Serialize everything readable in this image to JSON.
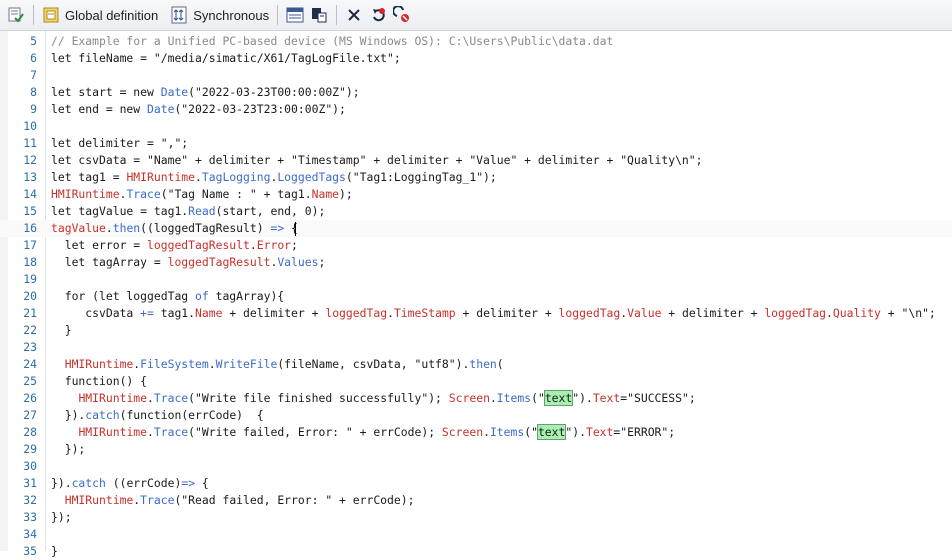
{
  "toolbar": {
    "global_definition_label": "Global definition",
    "synchronous_label": "Synchronous",
    "icons": [
      "check-script-icon",
      "global-definition-icon",
      "synchronous-icon",
      "tag-list-icon",
      "snippet-icon",
      "delete-icon",
      "refresh-icon",
      "stop-icon"
    ]
  },
  "colors": {
    "line_number": "#2b6da8",
    "object": "#c8312b",
    "member": "#3b6cc9",
    "comment": "#8a8a8a",
    "highlight": "#a8f0b0"
  },
  "editor": {
    "lines": [
      {
        "num": "5",
        "segments": [
          {
            "t": "// Example for a Unified PC-based device (MS Windows OS): C:\\Users\\Public\\data.dat",
            "c": "cmt"
          }
        ]
      },
      {
        "num": "6",
        "segments": [
          {
            "t": "let fileName = \"/media/simatic/X61/TagLogFile.txt\";",
            "c": "key"
          }
        ]
      },
      {
        "num": "7",
        "segments": []
      },
      {
        "num": "8",
        "segments": [
          {
            "t": "let start = new ",
            "c": "key"
          },
          {
            "t": "Date",
            "c": "blu"
          },
          {
            "t": "(\"2022-03-23T00:00:00Z\");",
            "c": "key"
          }
        ]
      },
      {
        "num": "9",
        "segments": [
          {
            "t": "let end = new ",
            "c": "key"
          },
          {
            "t": "Date",
            "c": "blu"
          },
          {
            "t": "(\"2022-03-23T23:00:00Z\");",
            "c": "key"
          }
        ]
      },
      {
        "num": "10",
        "segments": []
      },
      {
        "num": "11",
        "segments": [
          {
            "t": "let delimiter = \",\";",
            "c": "key"
          }
        ]
      },
      {
        "num": "12",
        "segments": [
          {
            "t": "let csvData = \"Name\" + delimiter + \"Timestamp\" + delimiter + \"Value\" + delimiter + \"Quality\\n\";",
            "c": "key"
          }
        ]
      },
      {
        "num": "13",
        "segments": [
          {
            "t": "let tag1 = ",
            "c": "key"
          },
          {
            "t": "HMIRuntime",
            "c": "obj"
          },
          {
            "t": ".",
            "c": "key"
          },
          {
            "t": "TagLogging",
            "c": "blu"
          },
          {
            "t": ".",
            "c": "key"
          },
          {
            "t": "LoggedTags",
            "c": "blu"
          },
          {
            "t": "(\"Tag1:LoggingTag_1\");",
            "c": "key"
          }
        ]
      },
      {
        "num": "14",
        "segments": [
          {
            "t": "HMIRuntime",
            "c": "obj"
          },
          {
            "t": ".",
            "c": "key"
          },
          {
            "t": "Trace",
            "c": "blu"
          },
          {
            "t": "(\"Tag Name : \" + tag1.",
            "c": "key"
          },
          {
            "t": "Name",
            "c": "obj"
          },
          {
            "t": ");",
            "c": "key"
          }
        ]
      },
      {
        "num": "15",
        "segments": [
          {
            "t": "let tagValue = tag1.",
            "c": "key"
          },
          {
            "t": "Read",
            "c": "blu"
          },
          {
            "t": "(start, end, 0);",
            "c": "key"
          }
        ]
      },
      {
        "num": "16",
        "segments": [
          {
            "t": "tagValue",
            "c": "obj"
          },
          {
            "t": ".",
            "c": "key"
          },
          {
            "t": "then",
            "c": "blu"
          },
          {
            "t": "((loggedTagResult) ",
            "c": "key"
          },
          {
            "t": "=>",
            "c": "blu"
          },
          {
            "t": " {",
            "c": "key"
          }
        ]
      },
      {
        "num": "17",
        "segments": [
          {
            "t": "  let error = ",
            "c": "key"
          },
          {
            "t": "loggedTagResult",
            "c": "obj"
          },
          {
            "t": ".",
            "c": "key"
          },
          {
            "t": "Error",
            "c": "obj"
          },
          {
            "t": ";",
            "c": "key"
          }
        ]
      },
      {
        "num": "18",
        "segments": [
          {
            "t": "  let tagArray = ",
            "c": "key"
          },
          {
            "t": "loggedTagResult",
            "c": "obj"
          },
          {
            "t": ".",
            "c": "key"
          },
          {
            "t": "Values",
            "c": "blu"
          },
          {
            "t": ";",
            "c": "key"
          }
        ]
      },
      {
        "num": "19",
        "segments": []
      },
      {
        "num": "20",
        "segments": [
          {
            "t": "  for (let loggedTag ",
            "c": "key"
          },
          {
            "t": "of",
            "c": "blu"
          },
          {
            "t": " tagArray){",
            "c": "key"
          }
        ]
      },
      {
        "num": "21",
        "segments": [
          {
            "t": "     csvData ",
            "c": "key"
          },
          {
            "t": "+=",
            "c": "blu"
          },
          {
            "t": " tag1.",
            "c": "key"
          },
          {
            "t": "Name",
            "c": "obj"
          },
          {
            "t": " + delimiter + ",
            "c": "key"
          },
          {
            "t": "loggedTag",
            "c": "obj"
          },
          {
            "t": ".",
            "c": "key"
          },
          {
            "t": "TimeStamp",
            "c": "obj"
          },
          {
            "t": " + delimiter + ",
            "c": "key"
          },
          {
            "t": "loggedTag",
            "c": "obj"
          },
          {
            "t": ".",
            "c": "key"
          },
          {
            "t": "Value",
            "c": "obj"
          },
          {
            "t": " + delimiter + ",
            "c": "key"
          },
          {
            "t": "loggedTag",
            "c": "obj"
          },
          {
            "t": ".",
            "c": "key"
          },
          {
            "t": "Quality",
            "c": "obj"
          },
          {
            "t": " + \"\\n\";",
            "c": "key"
          }
        ]
      },
      {
        "num": "22",
        "segments": [
          {
            "t": "  }",
            "c": "key"
          }
        ]
      },
      {
        "num": "23",
        "segments": []
      },
      {
        "num": "24",
        "segments": [
          {
            "t": "  ",
            "c": "key"
          },
          {
            "t": "HMIRuntime",
            "c": "obj"
          },
          {
            "t": ".",
            "c": "key"
          },
          {
            "t": "FileSystem",
            "c": "blu"
          },
          {
            "t": ".",
            "c": "key"
          },
          {
            "t": "WriteFile",
            "c": "blu"
          },
          {
            "t": "(fileName, csvData, \"utf8\").",
            "c": "key"
          },
          {
            "t": "then",
            "c": "blu"
          },
          {
            "t": "(",
            "c": "key"
          }
        ]
      },
      {
        "num": "25",
        "segments": [
          {
            "t": "  function() {",
            "c": "key"
          }
        ]
      },
      {
        "num": "26",
        "segments": [
          {
            "t": "    ",
            "c": "key"
          },
          {
            "t": "HMIRuntime",
            "c": "obj"
          },
          {
            "t": ".",
            "c": "key"
          },
          {
            "t": "Trace",
            "c": "blu"
          },
          {
            "t": "(\"Write file finished successfully\"); ",
            "c": "key"
          },
          {
            "t": "Screen",
            "c": "obj"
          },
          {
            "t": ".",
            "c": "key"
          },
          {
            "t": "Items",
            "c": "blu"
          },
          {
            "t": "(\"",
            "c": "key"
          },
          {
            "t": "text",
            "c": "hl"
          },
          {
            "t": "\").",
            "c": "key"
          },
          {
            "t": "Text",
            "c": "obj"
          },
          {
            "t": "=\"SUCCESS\";",
            "c": "key"
          }
        ]
      },
      {
        "num": "27",
        "segments": [
          {
            "t": "  }).",
            "c": "key"
          },
          {
            "t": "catch",
            "c": "blu"
          },
          {
            "t": "(function(errCode)  {",
            "c": "key"
          }
        ]
      },
      {
        "num": "28",
        "segments": [
          {
            "t": "    ",
            "c": "key"
          },
          {
            "t": "HMIRuntime",
            "c": "obj"
          },
          {
            "t": ".",
            "c": "key"
          },
          {
            "t": "Trace",
            "c": "blu"
          },
          {
            "t": "(\"Write failed, Error: \" + errCode); ",
            "c": "key"
          },
          {
            "t": "Screen",
            "c": "obj"
          },
          {
            "t": ".",
            "c": "key"
          },
          {
            "t": "Items",
            "c": "blu"
          },
          {
            "t": "(\"",
            "c": "key"
          },
          {
            "t": "text",
            "c": "hl"
          },
          {
            "t": "\").",
            "c": "key"
          },
          {
            "t": "Text",
            "c": "obj"
          },
          {
            "t": "=\"ERROR\";",
            "c": "key"
          }
        ]
      },
      {
        "num": "29",
        "segments": [
          {
            "t": "  });",
            "c": "key"
          }
        ]
      },
      {
        "num": "30",
        "segments": []
      },
      {
        "num": "31",
        "segments": [
          {
            "t": "}).",
            "c": "key"
          },
          {
            "t": "catch",
            "c": "blu"
          },
          {
            "t": " ((errCode)",
            "c": "key"
          },
          {
            "t": "=>",
            "c": "blu"
          },
          {
            "t": " {",
            "c": "key"
          }
        ]
      },
      {
        "num": "32",
        "segments": [
          {
            "t": "  ",
            "c": "key"
          },
          {
            "t": "HMIRuntime",
            "c": "obj"
          },
          {
            "t": ".",
            "c": "key"
          },
          {
            "t": "Trace",
            "c": "blu"
          },
          {
            "t": "(\"Read failed, Error: \" + errCode);",
            "c": "key"
          }
        ]
      },
      {
        "num": "33",
        "segments": [
          {
            "t": "});",
            "c": "key"
          }
        ]
      },
      {
        "num": "34",
        "segments": []
      },
      {
        "num": "35",
        "segments": [
          {
            "t": "}",
            "c": "key"
          }
        ]
      }
    ]
  }
}
